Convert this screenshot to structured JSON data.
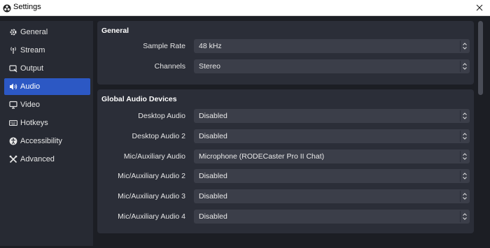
{
  "window": {
    "title": "Settings",
    "app_icon": "obs-logo-icon",
    "close_icon": "close-icon"
  },
  "colors": {
    "accent": "#2c58c4",
    "panel": "#2b2e38",
    "field": "#3b3e49",
    "background": "#1c1e24"
  },
  "sidebar": {
    "items": [
      {
        "label": "General",
        "icon": "gear-icon",
        "active": false
      },
      {
        "label": "Stream",
        "icon": "antenna-icon",
        "active": false
      },
      {
        "label": "Output",
        "icon": "output-icon",
        "active": false
      },
      {
        "label": "Audio",
        "icon": "speaker-icon",
        "active": true
      },
      {
        "label": "Video",
        "icon": "monitor-icon",
        "active": false
      },
      {
        "label": "Hotkeys",
        "icon": "keyboard-icon",
        "active": false
      },
      {
        "label": "Accessibility",
        "icon": "accessibility-icon",
        "active": false
      },
      {
        "label": "Advanced",
        "icon": "tools-icon",
        "active": false
      }
    ]
  },
  "general": {
    "title": "General",
    "rows": [
      {
        "label": "Sample Rate",
        "value": "48 kHz"
      },
      {
        "label": "Channels",
        "value": "Stereo"
      }
    ]
  },
  "devices": {
    "title": "Global Audio Devices",
    "rows": [
      {
        "label": "Desktop Audio",
        "value": "Disabled"
      },
      {
        "label": "Desktop Audio 2",
        "value": "Disabled"
      },
      {
        "label": "Mic/Auxiliary Audio",
        "value": "Microphone (RODECaster Pro II Chat)"
      },
      {
        "label": "Mic/Auxiliary Audio 2",
        "value": "Disabled"
      },
      {
        "label": "Mic/Auxiliary Audio 3",
        "value": "Disabled"
      },
      {
        "label": "Mic/Auxiliary Audio 4",
        "value": "Disabled"
      }
    ]
  }
}
